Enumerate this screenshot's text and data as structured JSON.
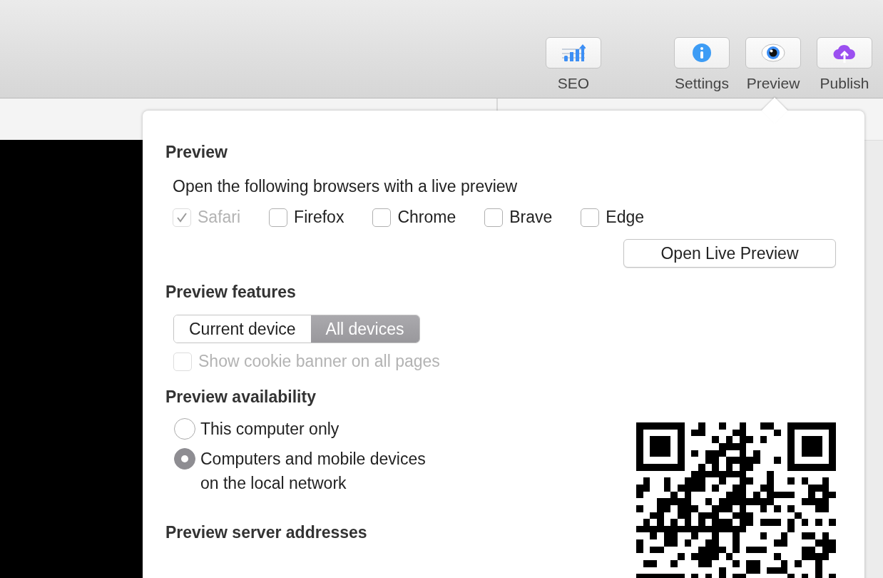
{
  "toolbar": [
    {
      "label": "SEO",
      "kind": "chart"
    },
    {
      "label": "Settings",
      "kind": "info"
    },
    {
      "label": "Preview",
      "kind": "eye"
    },
    {
      "label": "Publish",
      "kind": "upload"
    }
  ],
  "popover": {
    "preview": {
      "title": "Preview",
      "intro": "Open the following browsers with a live preview",
      "browsers": [
        {
          "label": "Safari",
          "checked": true,
          "disabled": true
        },
        {
          "label": "Firefox",
          "checked": false,
          "disabled": false
        },
        {
          "label": "Chrome",
          "checked": false,
          "disabled": false
        },
        {
          "label": "Brave",
          "checked": false,
          "disabled": false
        },
        {
          "label": "Edge",
          "checked": false,
          "disabled": false
        }
      ],
      "button": "Open Live Preview"
    },
    "features": {
      "title": "Preview features",
      "segments": [
        {
          "label": "Current device",
          "selected": false
        },
        {
          "label": "All devices",
          "selected": true
        }
      ],
      "cookie": {
        "label": "Show cookie banner on all pages",
        "checked": false,
        "disabled": true
      }
    },
    "availability": {
      "title": "Preview availability",
      "options": [
        {
          "label": "This computer only",
          "selected": false
        },
        {
          "label": "Computers and mobile devices on the local network",
          "selected": true
        }
      ]
    },
    "addresses": {
      "title": "Preview server addresses"
    }
  }
}
